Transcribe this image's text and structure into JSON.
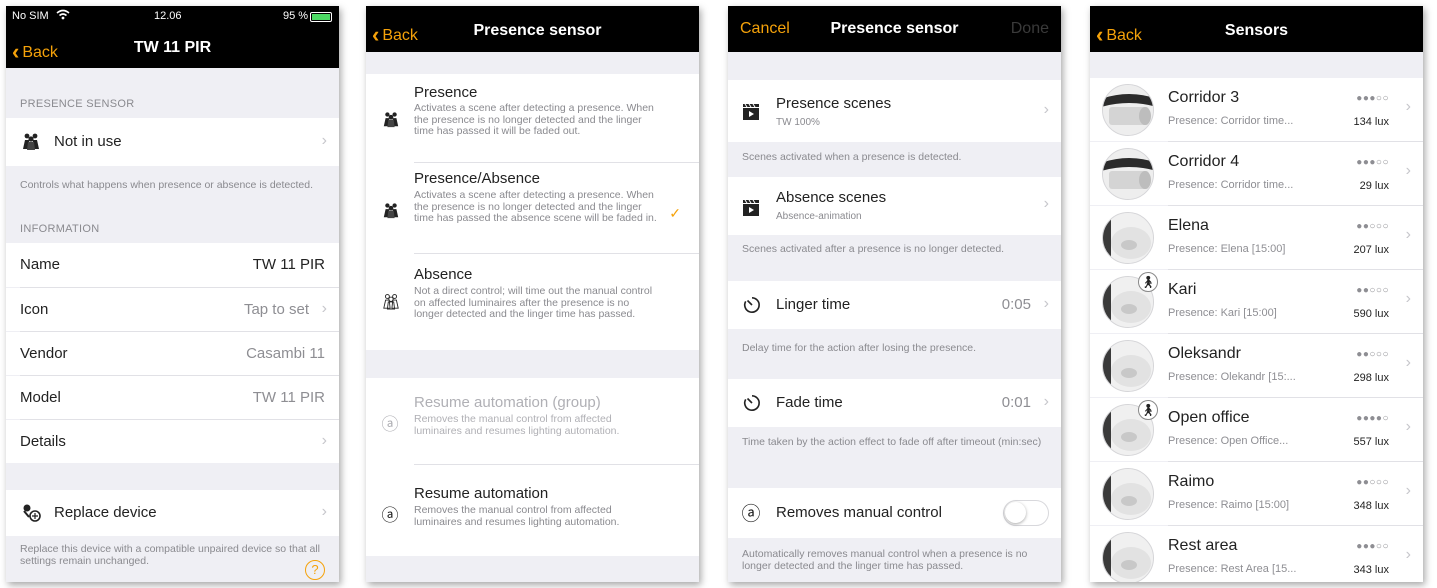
{
  "colors": {
    "accent": "#f5a20a",
    "nav_bg": "#000000",
    "group_bg": "#efeff4"
  },
  "screen1": {
    "status": {
      "carrier": "No SIM",
      "time": "12.06",
      "battery": "95 %"
    },
    "back_label": "Back",
    "title": "TW 11 PIR",
    "presence_header": "PRESENCE SENSOR",
    "presence_row": {
      "label": "Not in use"
    },
    "presence_footer": "Controls what happens when presence or absence is detected.",
    "info_header": "INFORMATION",
    "info_rows": [
      {
        "label": "Name",
        "value": "TW 11 PIR"
      },
      {
        "label": "Icon",
        "value": "Tap to set"
      },
      {
        "label": "Vendor",
        "value": "Casambi 11"
      },
      {
        "label": "Model",
        "value": "TW 11 PIR"
      },
      {
        "label": "Details",
        "value": ""
      }
    ],
    "replace_row": {
      "label": "Replace device"
    },
    "replace_footer": "Replace this device with a compatible unpaired device so that all settings remain unchanged.",
    "help_icon": "question-circle-icon"
  },
  "screen2": {
    "back_label": "Back",
    "title": "Presence sensor",
    "options": [
      {
        "title": "Presence",
        "desc": "Activates a scene after detecting a presence. When the presence is no longer detected and the linger time has passed it will be faded out.",
        "selected": false
      },
      {
        "title": "Presence/Absence",
        "desc": "Activates a scene after detecting a presence. When the presence is no longer detected and the linger time has passed the absence scene will be faded in.",
        "selected": true
      },
      {
        "title": "Absence",
        "desc": "Not a direct control; will time out the manual control on affected luminaires after the presence is no longer detected and the linger time has passed.",
        "selected": false
      }
    ],
    "automation": [
      {
        "title": "Resume automation (group)",
        "desc": "Removes the manual control from affected luminaires and resumes lighting automation.",
        "enabled": false
      },
      {
        "title": "Resume automation",
        "desc": "Removes the manual control from affected luminaires and resumes lighting automation.",
        "enabled": true
      }
    ]
  },
  "screen3": {
    "cancel_label": "Cancel",
    "title": "Presence sensor",
    "done_label": "Done",
    "presence_scenes": {
      "label": "Presence scenes",
      "sub": "TW 100%",
      "footer": "Scenes activated when a presence is detected."
    },
    "absence_scenes": {
      "label": "Absence scenes",
      "sub": "Absence-animation",
      "footer": "Scenes activated after a presence is no longer detected."
    },
    "linger": {
      "label": "Linger time",
      "value": "0:05",
      "footer": "Delay time for the action after losing the presence."
    },
    "fade": {
      "label": "Fade time",
      "value": "0:01",
      "footer": "Time taken by the action effect to fade off after timeout (min:sec)"
    },
    "manual": {
      "label": "Removes manual control",
      "on": false,
      "footer": "Automatically removes manual control when a presence is no longer detected and the linger time has passed."
    }
  },
  "screen4": {
    "back_label": "Back",
    "title": "Sensors",
    "sensors": [
      {
        "name": "Corridor 3",
        "sub": "Presence: Corridor time...",
        "strength": "●●●○○",
        "lux": "134 lux",
        "kind": "tube",
        "walker": false
      },
      {
        "name": "Corridor 4",
        "sub": "Presence: Corridor time...",
        "strength": "●●●○○",
        "lux": "29 lux",
        "kind": "tube",
        "walker": false
      },
      {
        "name": "Elena",
        "sub": "Presence: Elena [15:00]",
        "strength": "●●○○○",
        "lux": "207 lux",
        "kind": "dome",
        "walker": false
      },
      {
        "name": "Kari",
        "sub": "Presence: Kari [15:00]",
        "strength": "●●○○○",
        "lux": "590 lux",
        "kind": "dome",
        "walker": true
      },
      {
        "name": "Oleksandr",
        "sub": "Presence: Olekandr [15:...",
        "strength": "●●○○○",
        "lux": "298 lux",
        "kind": "dome",
        "walker": false
      },
      {
        "name": "Open office",
        "sub": "Presence: Open Office...",
        "strength": "●●●●○",
        "lux": "557 lux",
        "kind": "dome",
        "walker": true
      },
      {
        "name": "Raimo",
        "sub": "Presence: Raimo [15:00]",
        "strength": "●●○○○",
        "lux": "348 lux",
        "kind": "dome",
        "walker": false
      },
      {
        "name": "Rest area",
        "sub": "Presence: Rest Area [15...",
        "strength": "●●●○○",
        "lux": "343 lux",
        "kind": "dome",
        "walker": false
      }
    ]
  }
}
